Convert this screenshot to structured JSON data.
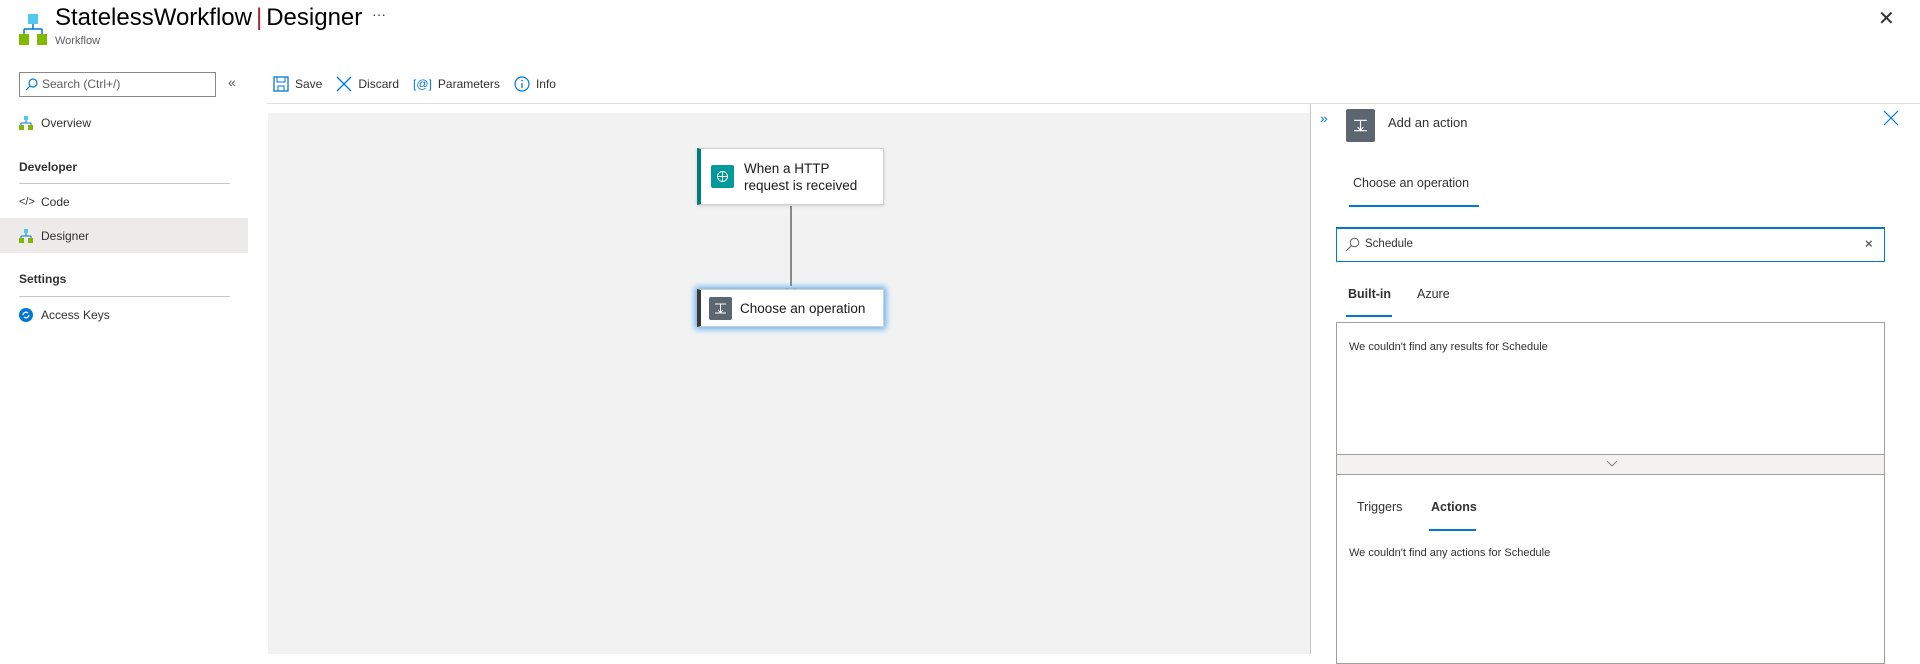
{
  "header": {
    "title": "StatelessWorkflow",
    "title_sep": "|",
    "page": "Designer",
    "subtitle": "Workflow",
    "more": "···",
    "close": "✕"
  },
  "sidebar": {
    "search_placeholder": "Search (Ctrl+/)",
    "collapse": "«",
    "overview": "Overview",
    "sections": [
      {
        "title": "Developer",
        "items": [
          "Code",
          "Designer"
        ]
      },
      {
        "title": "Settings",
        "items": [
          "Access Keys"
        ]
      }
    ],
    "selected": "Designer"
  },
  "toolbar": {
    "save": "Save",
    "discard": "Discard",
    "parameters": "Parameters",
    "info": "Info"
  },
  "canvas": {
    "trigger_card": "When a HTTP request is received",
    "action_card": "Choose an operation",
    "trigger_color": "#007c7c",
    "action_color": "#5b6670"
  },
  "panel": {
    "expand": "»",
    "title": "Add an action",
    "tab": "Choose an operation",
    "search_value": "Schedule",
    "source_tabs": [
      "Built-in",
      "Azure"
    ],
    "selected_source": "Built-in",
    "results_message": "We couldn't find any results for Schedule",
    "type_tabs": [
      "Triggers",
      "Actions"
    ],
    "selected_type": "Actions",
    "actions_message": "We couldn't find any actions for Schedule"
  },
  "colors": {
    "accent": "#0078d4"
  }
}
